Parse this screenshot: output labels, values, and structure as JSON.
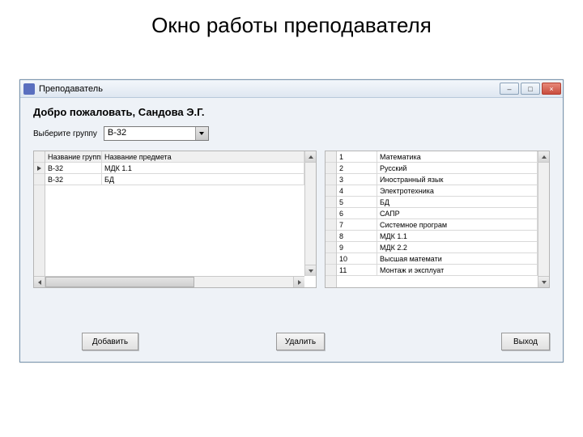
{
  "slide_title": "Окно работы преподавателя",
  "window": {
    "title": "Преподаватель",
    "min_label": "–",
    "max_label": "□",
    "close_label": "×"
  },
  "welcome": "Добро пожаловать, Сандова Э.Г.",
  "picker": {
    "label": "Выберите группу",
    "value": "В-32"
  },
  "left_grid": {
    "headers": [
      "Название группы",
      "Название предмета"
    ],
    "rows": [
      {
        "group": "В-32",
        "subject": "МДК 1.1"
      },
      {
        "group": "В-32",
        "subject": "БД"
      }
    ]
  },
  "right_grid": {
    "rows": [
      {
        "n": "1",
        "name": "Математика"
      },
      {
        "n": "2",
        "name": "Русский"
      },
      {
        "n": "3",
        "name": "Иностранный язык"
      },
      {
        "n": "4",
        "name": "Электротехника"
      },
      {
        "n": "5",
        "name": "БД"
      },
      {
        "n": "6",
        "name": "САПР"
      },
      {
        "n": "7",
        "name": "Системное програм"
      },
      {
        "n": "8",
        "name": "МДК 1.1"
      },
      {
        "n": "9",
        "name": "МДК 2.2"
      },
      {
        "n": "10",
        "name": "Высшая математи"
      },
      {
        "n": "11",
        "name": "Монтаж и эксплуат"
      }
    ]
  },
  "buttons": {
    "add": "Добавить",
    "delete": "Удалить",
    "exit": "Выход"
  }
}
